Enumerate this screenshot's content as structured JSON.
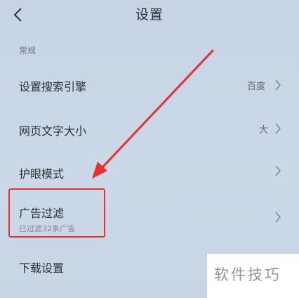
{
  "header": {
    "title": "设置",
    "back_icon": "chevron-left-icon"
  },
  "section": {
    "label": "常规"
  },
  "rows": [
    {
      "label": "设置搜索引擎",
      "value": "百度"
    },
    {
      "label": "网页文字大小",
      "value": "大"
    },
    {
      "label": "护眼模式",
      "value": ""
    },
    {
      "label": "广告过滤",
      "sub": "已过滤32条广告"
    },
    {
      "label": "下载设置"
    }
  ],
  "annotation": {
    "color": "#ee2f2f"
  },
  "watermark": {
    "text": "软件技巧"
  }
}
